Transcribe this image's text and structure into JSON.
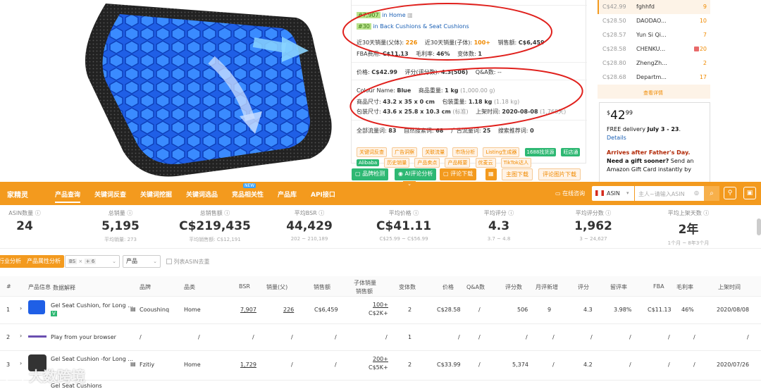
{
  "product": {
    "rank_main": "#7,907",
    "rank_main_cat": "in Home",
    "rank_sub": "#30",
    "rank_sub_cat": "in Back Cushions & Seat Cushions",
    "sales30_parent_label": "近30天销量(父体):",
    "sales30_parent": "226",
    "sales30_child_label": "近30天销量(子体):",
    "sales30_child": "100+",
    "revenue_label": "销售额:",
    "revenue": "C$6,459",
    "fba_label": "FBA费用:",
    "fba": "C$11.13",
    "margin_label": "毛利率:",
    "margin": "46%",
    "variants_label": "变体数:",
    "variants": "1",
    "price_label": "价格:",
    "price": "C$42.99",
    "rating_label": "评分(评分数):",
    "rating": "4.3(506)",
    "qa_label": "Q&A数:",
    "qa": "--",
    "colour_label": "Colour Name:",
    "colour": "Blue",
    "weight_label": "商品重量:",
    "weight": "1 kg",
    "weight_g": "(1,000.00 g)",
    "size_label": "商品尺寸:",
    "size": "43.2 x 35 x 0 cm",
    "pkg_weight_label": "包装重量:",
    "pkg_weight": "1.18 kg",
    "pkg_weight_sub": "(1.18 kg)",
    "pkg_size_label": "包装尺寸:",
    "pkg_size": "43.6 x 25.8 x 10.3 cm",
    "pkg_size_sub": "(标准)",
    "launch_label": "上架时间:",
    "launch": "2020-08-08",
    "launch_sub": "(1,768天)",
    "traffic_all_label": "全部流量词:",
    "traffic_all": "83",
    "traffic_nat_label": "自然搜索词:",
    "traffic_nat": "68",
    "traffic_ad_label": "广告流量词:",
    "traffic_ad": "25",
    "traffic_rec_label": "搜索推荐词:",
    "traffic_rec": "0"
  },
  "tags_row1": [
    "关键词反查",
    "广告洞察",
    "关联流量",
    "市场分析",
    "Listing生成器",
    "1688找货源",
    "旺店通"
  ],
  "tags_row2": [
    "Alibaba",
    "历史销量",
    "产品卖点",
    "产品概要",
    "优麦云",
    "TikTok达人"
  ],
  "actions": {
    "brand": "品牌检测",
    "ai": "AI评论分析",
    "review_dl": "评论下载",
    "main_img_dl": "主图下载",
    "review_img_dl": "评论图片下载"
  },
  "sellers": [
    {
      "price": "C$42.99",
      "name": "fghhfd",
      "count": "9"
    },
    {
      "price": "C$28.50",
      "name": "DAODAO...",
      "count": "10"
    },
    {
      "price": "C$28.57",
      "name": "Yun Si Qi...",
      "count": "7"
    },
    {
      "price": "C$28.58",
      "name": "CHENKU...",
      "count": "20"
    },
    {
      "price": "C$28.80",
      "name": "ZhengZh...",
      "count": "2"
    },
    {
      "price": "C$28.68",
      "name": "Departm...",
      "count": "17"
    }
  ],
  "sellers_more": "查看详情",
  "buybox": {
    "currency": "$",
    "price_whole": "42",
    "price_cents": "99",
    "delivery": "FREE delivery",
    "delivery_date": "July 3 - 23",
    "details": "Details",
    "arrives": "Arrives after Father's Day.",
    "gift_q": "Need a gift sooner?",
    "gift_text": " Send an Amazon Gift Card instantly by"
  },
  "nav": {
    "logo": "家精灵",
    "items": [
      "产品查询",
      "关键词反查",
      "关键词挖掘",
      "关键词选品",
      "竞品相关性",
      "产品库",
      "API接口"
    ],
    "new_badge": "NEW",
    "online": "在线咨询",
    "country": "ASIN",
    "search_placeholder": "主人~请输入ASIN"
  },
  "stats": [
    {
      "label": "ASIN数量",
      "value": "24",
      "sub": ""
    },
    {
      "label": "总销量",
      "value": "5,195",
      "sub": "平均销量: 273"
    },
    {
      "label": "总销售额",
      "value": "C$219,435",
      "sub": "平均销售额: C$12,191"
    },
    {
      "label": "平均BSR",
      "value": "44,429",
      "sub": "202 ~ 210,189"
    },
    {
      "label": "平均价格",
      "value": "C$41.11",
      "sub": "C$25.99 ~ C$56.99"
    },
    {
      "label": "平均评分",
      "value": "4.3",
      "sub": "3.7 ~ 4.8"
    },
    {
      "label": "平均评分数",
      "value": "1,962",
      "sub": "3 ~ 24,627"
    },
    {
      "label": "平均上架天数",
      "value": "2年",
      "sub": "1个月 ~ 8年3个月"
    }
  ],
  "filters": {
    "btn1": "行业分析",
    "btn2": "产品属性分析",
    "select1_tag": "BS",
    "select1_more": "+ 6",
    "select2": "产品",
    "dedupe": "列表ASIN去重"
  },
  "table": {
    "headers": [
      "#",
      "产品信息",
      "品牌",
      "品类",
      "BSR",
      "销量(父)",
      "销售额",
      "子体销量",
      "变体数",
      "价格",
      "Q&A数",
      "评分数",
      "月评新增",
      "评分",
      "留评率",
      "FBA",
      "毛利率",
      "上架时间"
    ],
    "header_sub": "销售额",
    "header_hint": "数据解释",
    "rows": [
      {
        "idx": "1",
        "title": "Gel Seat Cushion, for Long ...",
        "badge": "V",
        "brand": "Cooushinq",
        "cat": "Home",
        "bsr": "7,907",
        "sales": "226",
        "rev": "C$6,459",
        "child": "100+",
        "child_sub": "C$2K+",
        "var": "2",
        "price": "C$28.58",
        "qa": "/",
        "rcount": "506",
        "rnew": "9",
        "rating": "4.3",
        "rrate": "3.98%",
        "fba": "C$11.13",
        "margin": "46%",
        "date": "2020/08/08"
      },
      {
        "idx": "2",
        "title": "Play from your browser",
        "badge": "",
        "brand": "/",
        "cat": "/",
        "bsr": "/",
        "sales": "/",
        "rev": "/",
        "child": "/",
        "child_sub": "",
        "var": "1",
        "price": "/",
        "qa": "/",
        "rcount": "/",
        "rnew": "/",
        "rating": "/",
        "rrate": "/",
        "fba": "/",
        "margin": "/",
        "date": "/"
      },
      {
        "idx": "3",
        "title": "Gel Seat Cushion -for Long ...",
        "badge": "",
        "brand": "Fzitiy",
        "cat": "Home",
        "bsr": "1,729",
        "sales": "/",
        "rev": "/",
        "child": "200+",
        "child_sub": "C$5K+",
        "var": "2",
        "price": "C$33.99",
        "qa": "/",
        "rcount": "5,374",
        "rnew": "/",
        "rating": "4.2",
        "rrate": "/",
        "fba": "/",
        "margin": "/",
        "date": "2020/07/26"
      }
    ],
    "row4_title": "Gel Seat Cushions"
  },
  "watermark": "大数跨境"
}
